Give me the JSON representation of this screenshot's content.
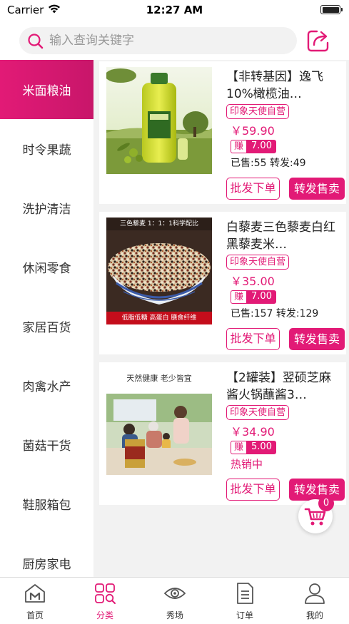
{
  "status_bar": {
    "carrier": "Carrier",
    "time": "12:27 AM"
  },
  "search": {
    "placeholder": "输入查询关键字",
    "icon": "search-icon"
  },
  "header": {
    "share_icon": "share-icon"
  },
  "sidebar": {
    "items": [
      {
        "label": "米面粮油",
        "active": true
      },
      {
        "label": "时令果蔬",
        "active": false
      },
      {
        "label": "洗护清洁",
        "active": false
      },
      {
        "label": "休闲零食",
        "active": false
      },
      {
        "label": "家居百货",
        "active": false
      },
      {
        "label": "肉禽水产",
        "active": false
      },
      {
        "label": "菌菇干货",
        "active": false
      },
      {
        "label": "鞋服箱包",
        "active": false
      },
      {
        "label": "厨房家电",
        "active": false
      }
    ]
  },
  "products": [
    {
      "title": "【非转基因】逸飞10%橄榄油…",
      "tag": "印象天使自营",
      "price": "￥59.90",
      "earn_label": "赚",
      "earn_value": "7.00",
      "sales": "已售:55 转发:49",
      "order_label": "批发下单",
      "resell_label": "转发售卖"
    },
    {
      "title": "白藜麦三色藜麦白红黑藜麦米…",
      "tag": "印象天使自营",
      "price": "￥35.00",
      "earn_label": "赚",
      "earn_value": "7.00",
      "sales": "已售:157 转发:129",
      "order_label": "批发下单",
      "resell_label": "转发售卖",
      "image_top_text": "三色藜麦 1：1：1科学配比",
      "image_bottom_text": "低脂低糖 高蛋白 膳食纤维"
    },
    {
      "title": "【2罐装】翌硕芝麻酱火锅蘸酱3…",
      "tag": "印象天使自营",
      "price": "￥34.90",
      "earn_label": "赚",
      "earn_value": "5.00",
      "hot": "热销中",
      "order_label": "批发下单",
      "resell_label": "转发售卖",
      "image_header_text": "天然健康 老少皆宜"
    }
  ],
  "cart": {
    "icon": "cart-icon",
    "badge": "0"
  },
  "tab_bar": {
    "items": [
      {
        "label": "首页",
        "icon": "home-icon",
        "active": false
      },
      {
        "label": "分类",
        "icon": "category-icon",
        "active": true
      },
      {
        "label": "秀场",
        "icon": "eye-icon",
        "active": false
      },
      {
        "label": "订单",
        "icon": "order-icon",
        "active": false
      },
      {
        "label": "我的",
        "icon": "profile-icon",
        "active": false
      }
    ]
  },
  "colors": {
    "accent": "#e21a76",
    "background": "#f2f2f2"
  }
}
